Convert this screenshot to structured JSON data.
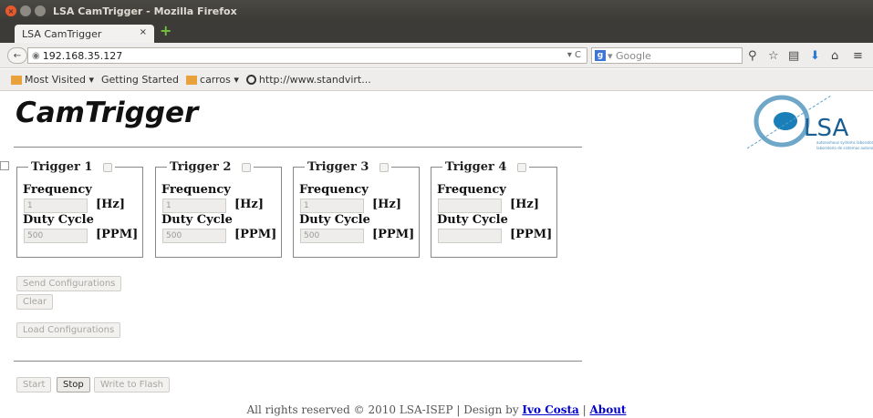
{
  "window": {
    "title": "LSA CamTrigger - Mozilla Firefox"
  },
  "tab": {
    "label": "LSA CamTrigger",
    "close": "×",
    "new": "+"
  },
  "nav": {
    "back": "←",
    "url": "192.168.35.127",
    "reload": "▾ C",
    "search_placeholder": "▾ Google",
    "search_engine": "g"
  },
  "bookmarks": [
    {
      "label": "Most Visited ▾",
      "icon": "folder-icon"
    },
    {
      "label": "Getting Started",
      "icon": "page-icon"
    },
    {
      "label": "carros ▾",
      "icon": "folder-icon"
    },
    {
      "label": "http://www.standvirt...",
      "icon": "globe-icon"
    }
  ],
  "app": {
    "title": "CamTrigger"
  },
  "labels": {
    "frequency": "Frequency",
    "duty_cycle": "Duty Cycle",
    "hz": "[Hz]",
    "ppm": "[PPM]"
  },
  "triggers": [
    {
      "name": "Trigger 1",
      "frequency": "1",
      "duty": "500"
    },
    {
      "name": "Trigger 2",
      "frequency": "1",
      "duty": "500"
    },
    {
      "name": "Trigger 3",
      "frequency": "1",
      "duty": "500"
    },
    {
      "name": "Trigger 4",
      "frequency": "",
      "duty": ""
    }
  ],
  "buttons": {
    "send": "Send Configurations",
    "clear": "Clear",
    "load": "Load Configurations",
    "start": "Start",
    "stop": "Stop",
    "flash": "Write to Flash"
  },
  "footer": {
    "text": "All rights reserved © 2010 LSA-ISEP | Design by ",
    "author": "Ivo Costa",
    "sep": " | ",
    "about": "About"
  },
  "colors": {
    "accent": "#e9592b",
    "link": "#0000cc",
    "logo": "#1a7fb8"
  }
}
